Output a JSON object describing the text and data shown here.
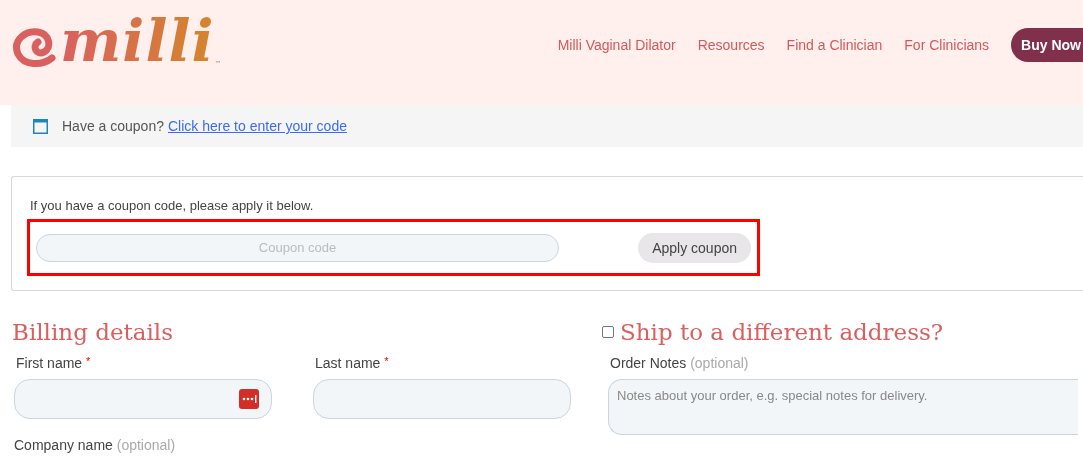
{
  "header": {
    "logo": {
      "text": "milli",
      "trademark": "™"
    },
    "nav": [
      "Milli Vaginal Dilator",
      "Resources",
      "Find a Clinician",
      "For Clinicians"
    ],
    "cta": "Buy Now"
  },
  "coupon_notice": {
    "text": "Have a coupon?",
    "link": "Click here to enter your code"
  },
  "coupon_form": {
    "hint": "If you have a coupon code, please apply it below.",
    "placeholder": "Coupon code",
    "button": "Apply coupon",
    "highlighted": true
  },
  "billing": {
    "title": "Billing details",
    "fields": [
      {
        "label": "First name",
        "required": "*",
        "autofill_icon": true
      },
      {
        "label": "Last name",
        "required": "*",
        "autofill_icon": false
      }
    ],
    "company": {
      "label": "Company name",
      "optional": "(optional)"
    }
  },
  "shipping": {
    "title": "Ship to a different address?",
    "checked": false,
    "notes": {
      "label": "Order Notes",
      "optional": "(optional)",
      "placeholder": "Notes about your order, e.g. special notes for delivery."
    }
  }
}
